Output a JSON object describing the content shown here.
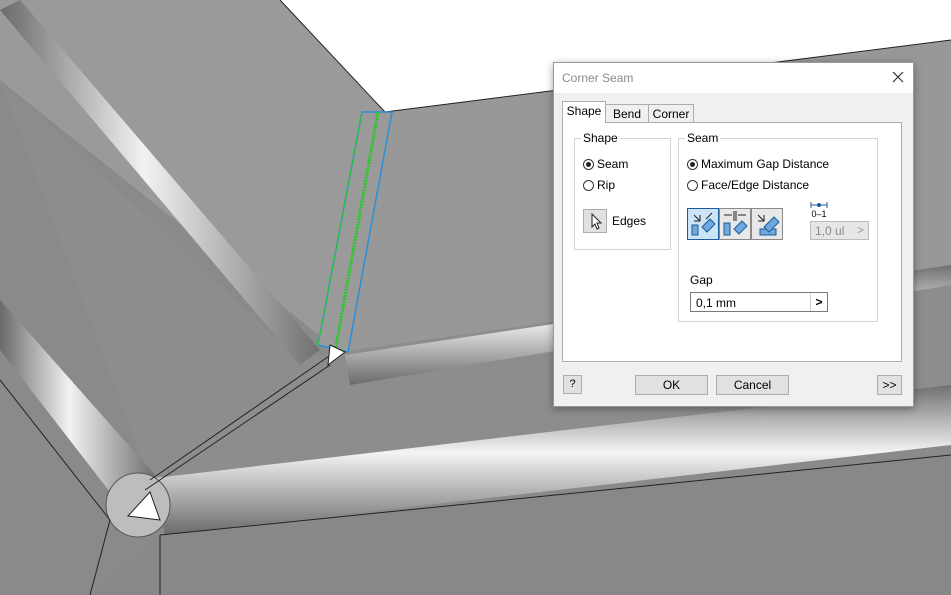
{
  "dialog": {
    "title": "Corner Seam",
    "tabs": [
      {
        "label": "Shape",
        "active": true
      },
      {
        "label": "Bend",
        "active": false
      },
      {
        "label": "Corner",
        "active": false
      }
    ],
    "shape_group": {
      "title": "Shape",
      "options": [
        {
          "label": "Seam",
          "checked": true
        },
        {
          "label": "Rip",
          "checked": false
        }
      ],
      "edges_label": "Edges"
    },
    "seam_group": {
      "title": "Seam",
      "options": [
        {
          "label": "Maximum Gap Distance",
          "checked": true
        },
        {
          "label": "Face/Edge Distance",
          "checked": false
        }
      ],
      "ratio_value": "1,0 ul",
      "ratio_icon_label": "0–1",
      "gap_label": "Gap",
      "gap_value": "0,1 mm"
    },
    "buttons": {
      "ok": "OK",
      "cancel": "Cancel",
      "more": ">>",
      "help": "?"
    }
  },
  "colors": {
    "model_face": "#8c8c8c",
    "seam_highlight": "#22cc22",
    "edge_highlight": "#2a90d8",
    "accent": "#1c5d99"
  }
}
